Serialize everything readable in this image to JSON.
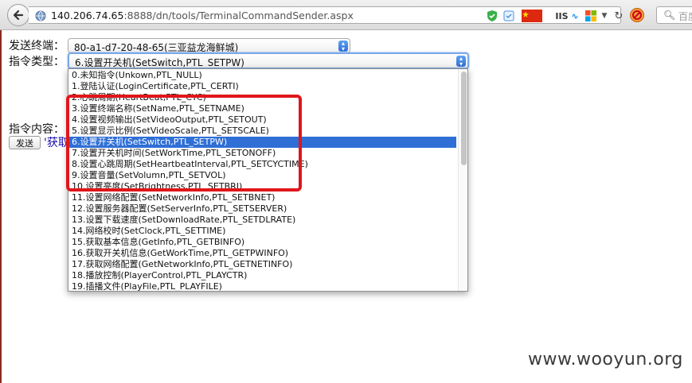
{
  "browser": {
    "url_host": "140.206.74.65",
    "url_path": ":8888/dn/tools/TerminalCommandSender.aspx",
    "iis_label": "IIS",
    "search_placeholder": "百度"
  },
  "form": {
    "terminal_label": "发送终端：",
    "terminal_value": "80-a1-d7-20-48-65(三亚益龙海鲜城)",
    "command_type_label": "指令类型：",
    "command_type_value": "6.设置开关机(SetSwitch,PTL_SETPW)",
    "content_label": "指令内容：",
    "send_button": "发送",
    "link_text": "'获取"
  },
  "dropdown": {
    "selected_index": 6,
    "options": [
      "0.未知指令(Unkown,PTL_NULL)",
      "1.登陆认证(LoginCertificate,PTL_CERTI)",
      "2.心跳周期(HeartBeat,PTL_CYC)",
      "3.设置终端名称(SetName,PTL_SETNAME)",
      "4.设置视频输出(SetVideoOutput,PTL_SETOUT)",
      "5.设置显示比例(SetVideoScale,PTL_SETSCALE)",
      "6.设置开关机(SetSwitch,PTL_SETPW)",
      "7.设置开关机时间(SetWorkTime,PTL_SETONOFF)",
      "8.设置心跳周期(SetHeartbeatInterval,PTL_SETCYCTIME)",
      "9.设置音量(SetVolumn,PTL_SETVOL)",
      "10.设置亮度(SetBrightness,PTL_SETBRI)",
      "11.设置网络配置(SetNetworkInfo,PTL_SETBNET)",
      "12.设置服务器配置(SetServerInfo,PTL_SETSERVER)",
      "13.设置下载速度(SetDownloadRate,PTL_SETDLRATE)",
      "14.网络校时(SetClock,PTL_SETTIME)",
      "15.获取基本信息(GetInfo,PTL_GETBINFO)",
      "16.获取开关机信息(GetWorkTime,PTL_GETPWINFO)",
      "17.获取网络配置(GetNetworkInfo,PTL_GETNETINFO)",
      "18.播放控制(PlayerControl,PTL_PLAYCTR)",
      "19.插播文件(PlayFile,PTL_PLAYFILE)"
    ]
  },
  "colors": {
    "highlight": "#2f6fd6",
    "annotation_box": "#e0161b"
  },
  "watermark": "www.wooyun.org"
}
